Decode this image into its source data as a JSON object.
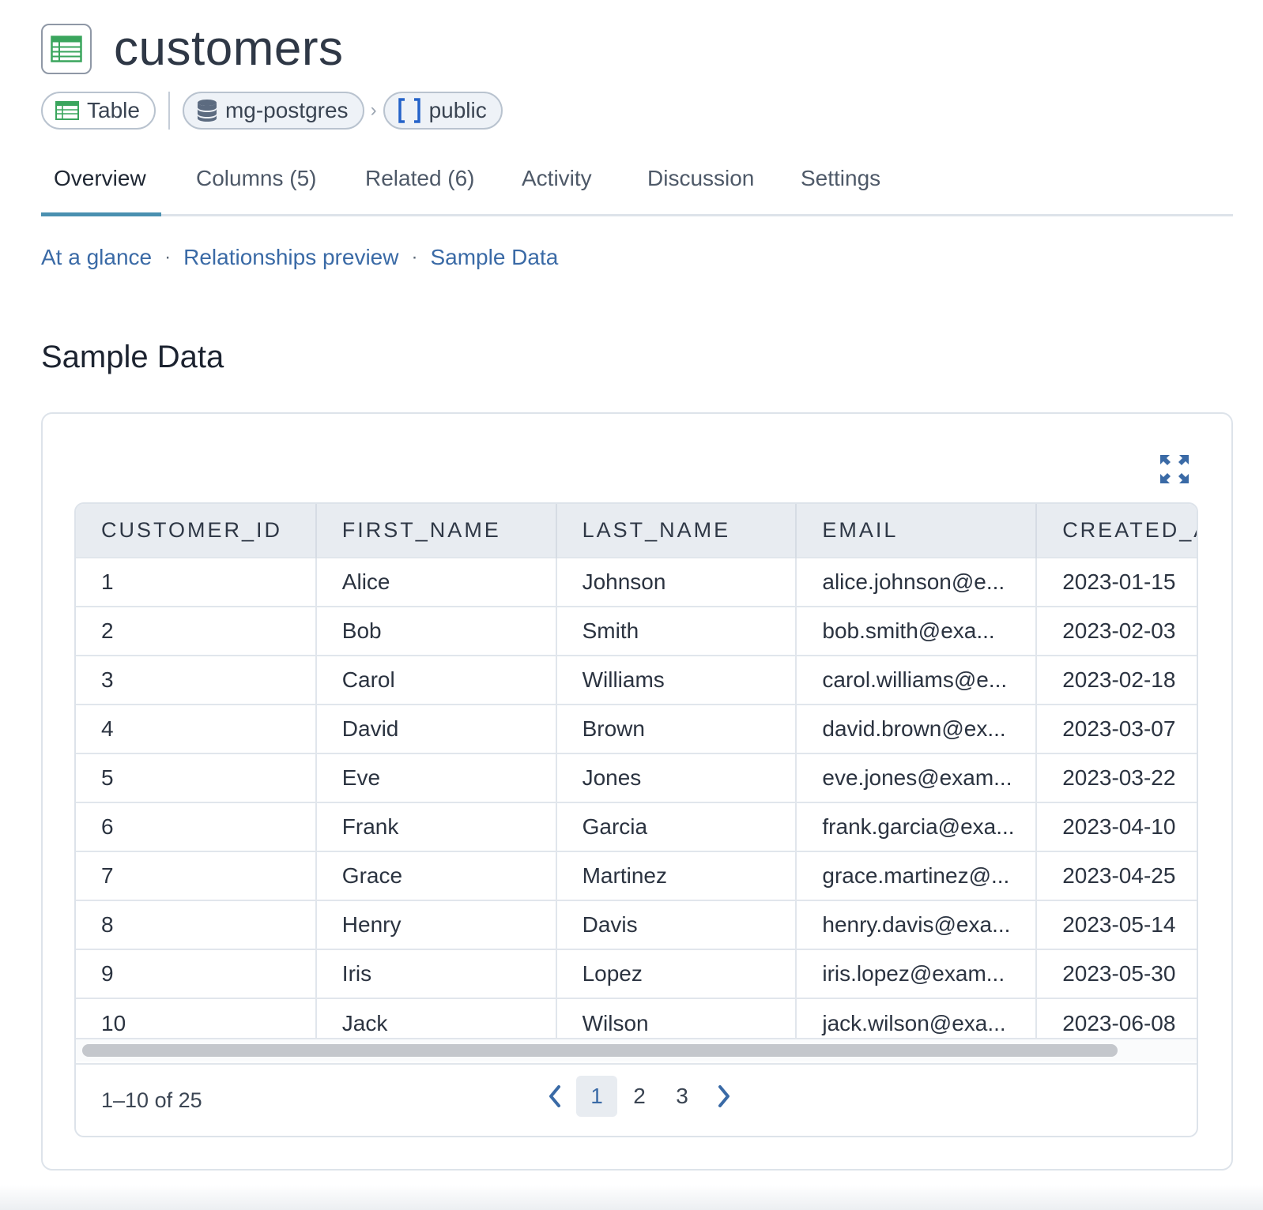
{
  "header": {
    "title": "customers",
    "icon": "table-icon",
    "type_pill": {
      "label": "Table",
      "icon": "table-icon"
    },
    "database_pill": {
      "label": "mg-postgres",
      "icon": "database-icon"
    },
    "separator": "›",
    "schema_pill": {
      "label": "public",
      "icon": "schema-brackets-icon"
    }
  },
  "tabs": [
    {
      "label": "Overview",
      "active": true
    },
    {
      "label": "Columns (5)",
      "active": false
    },
    {
      "label": "Related (6)",
      "active": false
    },
    {
      "label": "Activity",
      "active": false
    },
    {
      "label": "Discussion",
      "active": false
    },
    {
      "label": "Settings",
      "active": false
    }
  ],
  "anchors": [
    "At a glance",
    "Relationships preview",
    "Sample Data"
  ],
  "anchor_separator": "·",
  "section": {
    "title": "Sample Data"
  },
  "table": {
    "columns": [
      "CUSTOMER_ID",
      "FIRST_NAME",
      "LAST_NAME",
      "EMAIL",
      "CREATED_AT"
    ],
    "rows": [
      [
        "1",
        "Alice",
        "Johnson",
        "alice.johnson@e...",
        "2023-01-15"
      ],
      [
        "2",
        "Bob",
        "Smith",
        "bob.smith@exa...",
        "2023-02-03"
      ],
      [
        "3",
        "Carol",
        "Williams",
        "carol.williams@e...",
        "2023-02-18"
      ],
      [
        "4",
        "David",
        "Brown",
        "david.brown@ex...",
        "2023-03-07"
      ],
      [
        "5",
        "Eve",
        "Jones",
        "eve.jones@exam...",
        "2023-03-22"
      ],
      [
        "6",
        "Frank",
        "Garcia",
        "frank.garcia@exa...",
        "2023-04-10"
      ],
      [
        "7",
        "Grace",
        "Martinez",
        "grace.martinez@...",
        "2023-04-25"
      ],
      [
        "8",
        "Henry",
        "Davis",
        "henry.davis@exa...",
        "2023-05-14"
      ],
      [
        "9",
        "Iris",
        "Lopez",
        "iris.lopez@exam...",
        "2023-05-30"
      ],
      [
        "10",
        "Jack",
        "Wilson",
        "jack.wilson@exa...",
        "2023-06-08"
      ]
    ]
  },
  "pagination": {
    "range_text": "1–10 of 25",
    "pages": [
      "1",
      "2",
      "3"
    ],
    "current_page": "1"
  },
  "colors": {
    "accent": "#4a90b0",
    "link": "#3a6aa6",
    "table_icon_green": "#3aa55d",
    "database_icon": "#5c6b80",
    "schema_icon": "#2563c9"
  }
}
